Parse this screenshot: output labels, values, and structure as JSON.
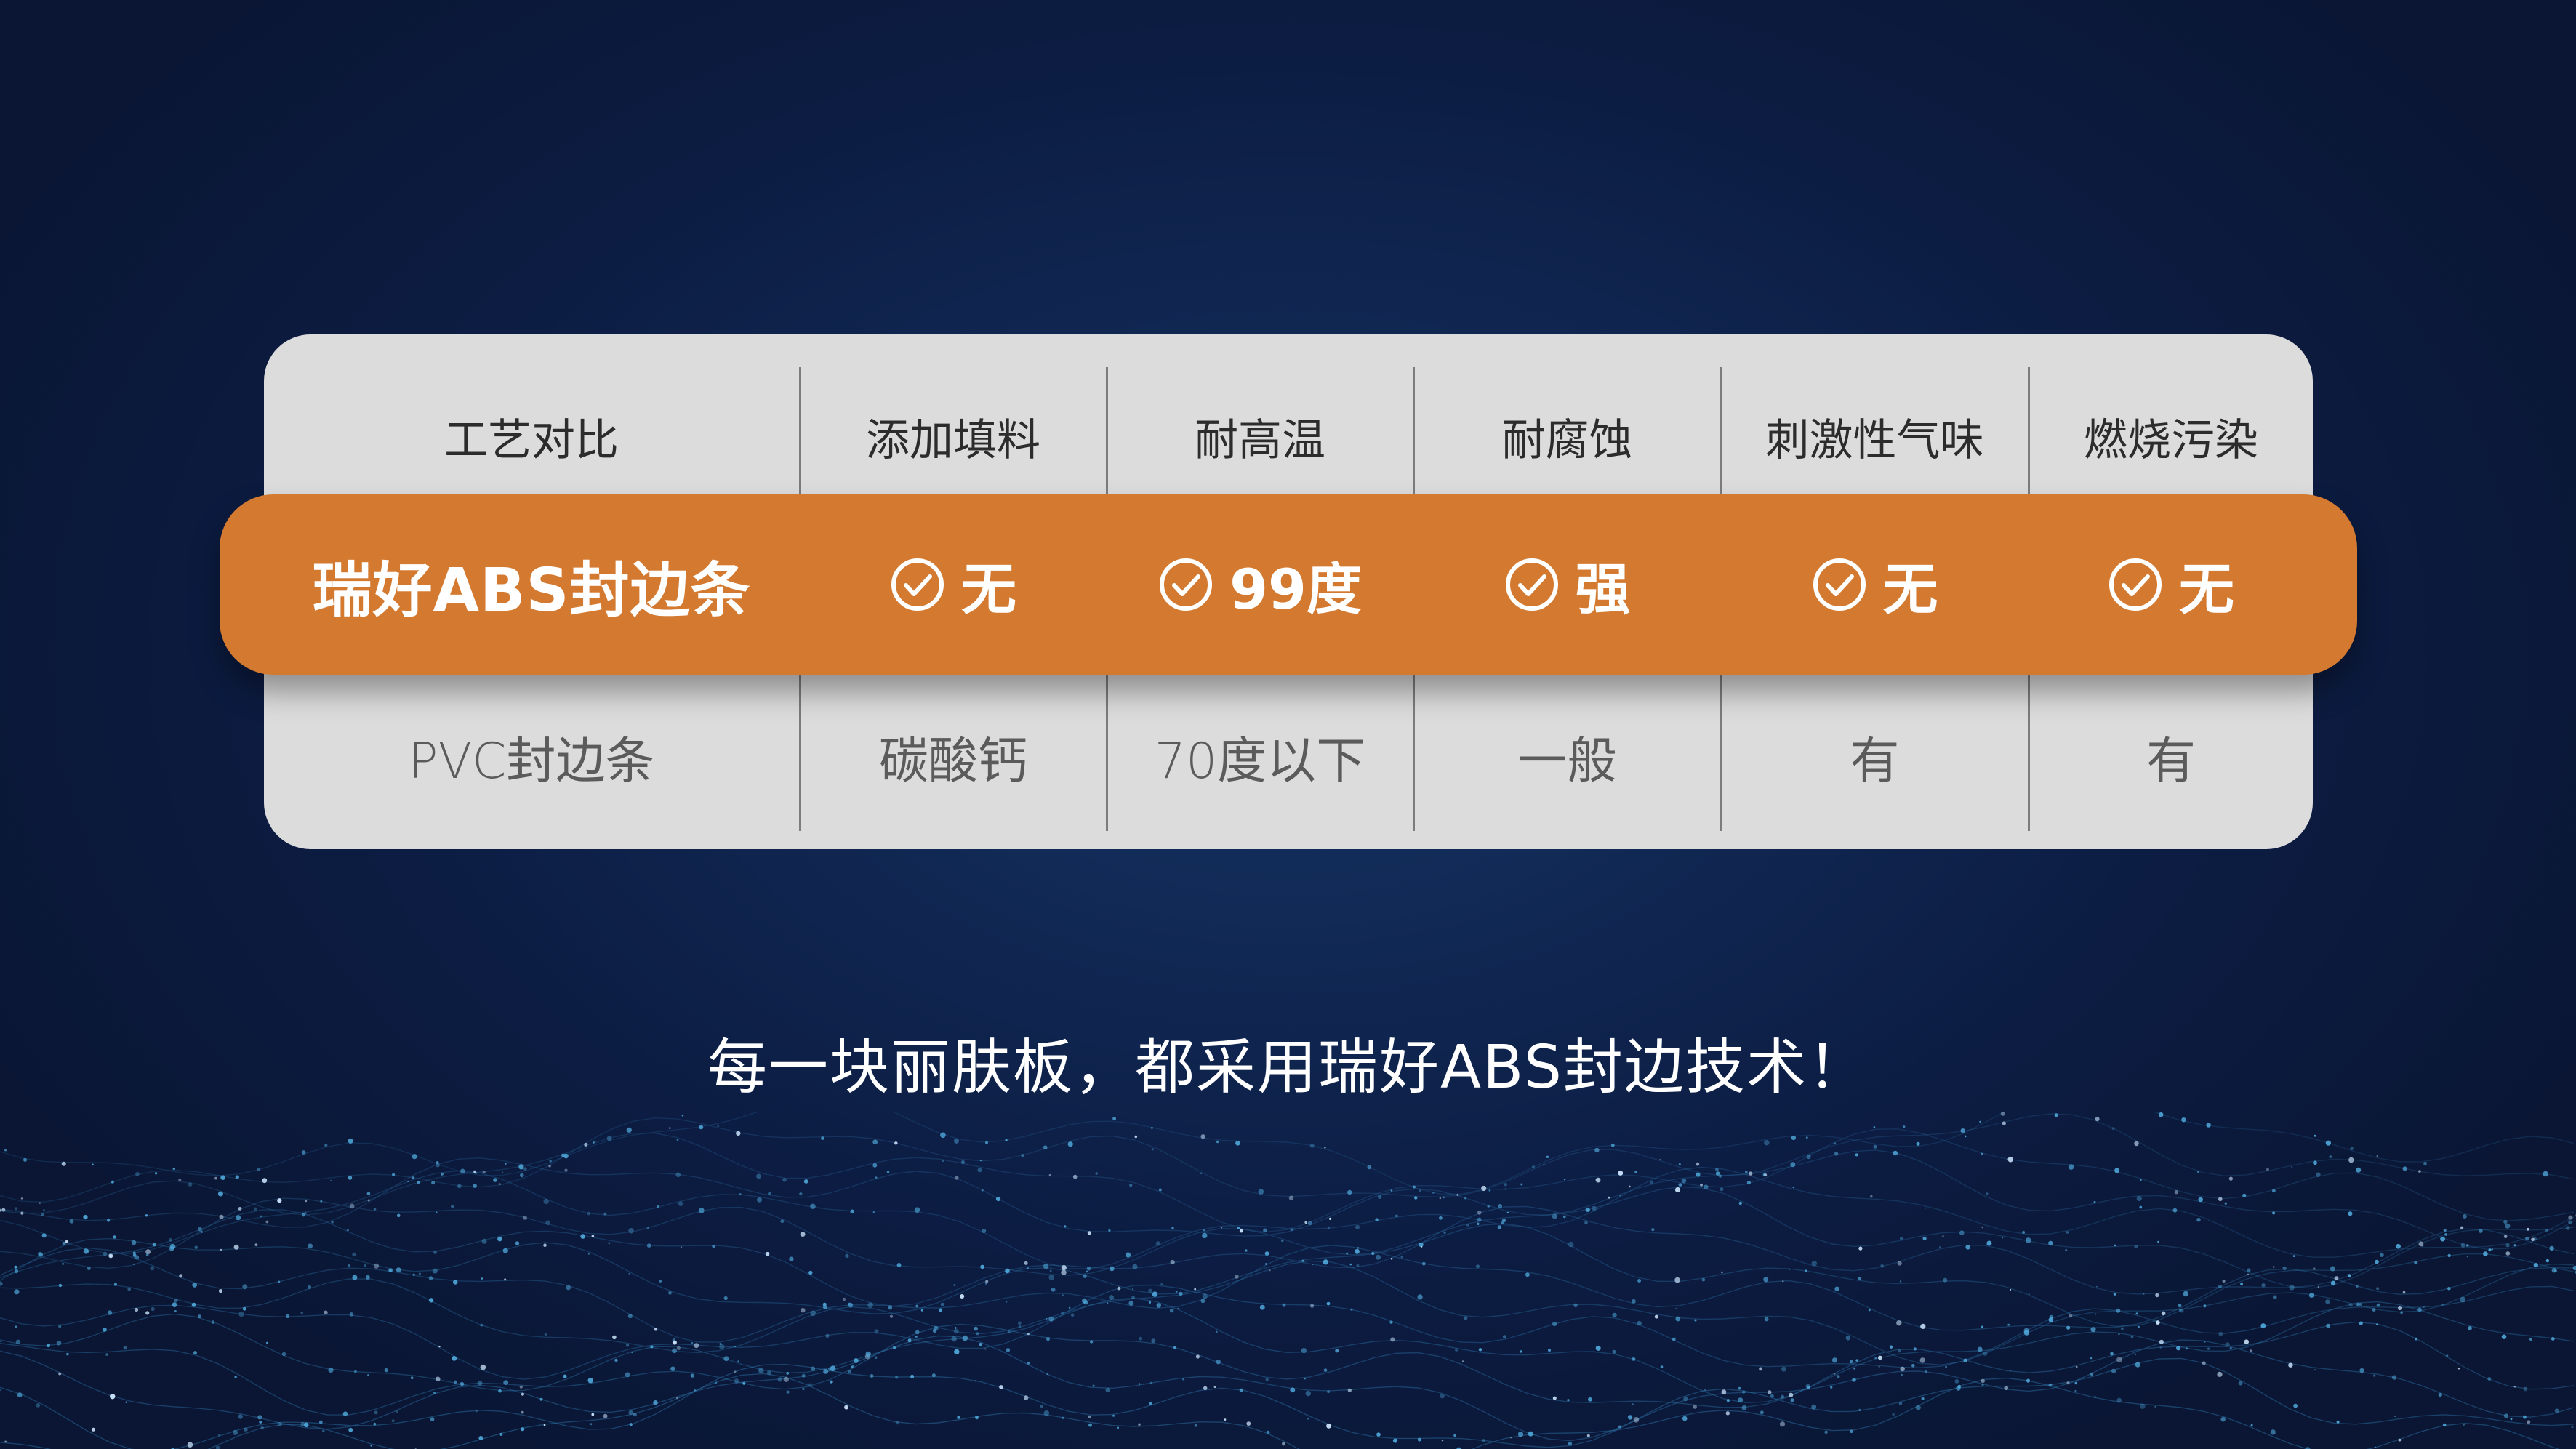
{
  "table": {
    "headers": [
      "工艺对比",
      "添加填料",
      "耐高温",
      "耐腐蚀",
      "刺激性气味",
      "燃烧污染"
    ],
    "abs_row": {
      "name": "瑞好ABS封边条",
      "values": [
        "无",
        "99度",
        "强",
        "无",
        "无"
      ],
      "icon": "check-circle-icon"
    },
    "pvc_row": {
      "name": "PVC封边条",
      "values": [
        "碳酸钙",
        "70度以下",
        "一般",
        "有",
        "有"
      ]
    }
  },
  "tagline": "每一块丽肤板，都采用瑞好ABS封边技术！",
  "colors": {
    "background": "#0f2450",
    "card": "#dcdcdc",
    "highlight": "#d47a30",
    "text_light": "#ffffff",
    "text_dark": "#2c2c2c",
    "text_muted": "#5b5b5b"
  }
}
